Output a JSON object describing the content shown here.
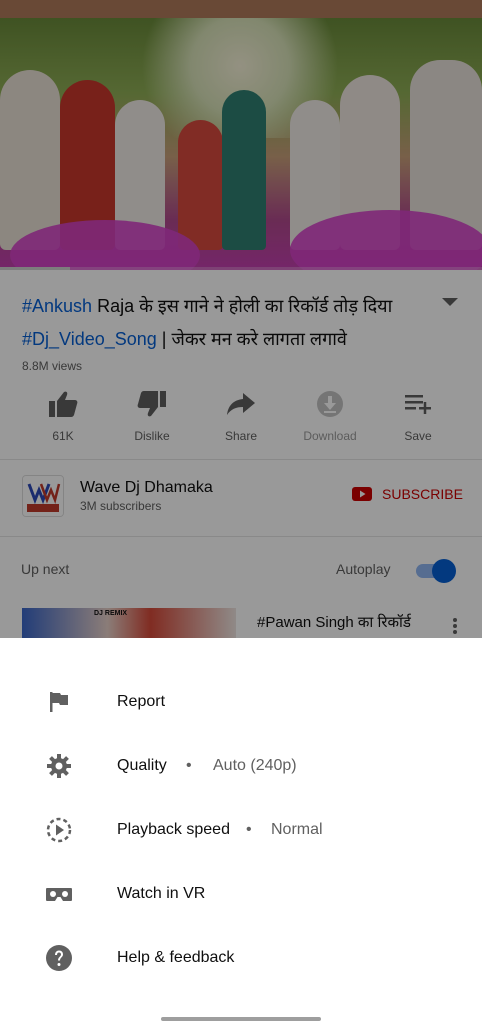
{
  "video": {
    "title_tag1": "#Ankush",
    "title_line1": " Raja के इस गाने ने होली का रिकॉर्ड तोड़ दिया",
    "title_tag2": "#Dj_Video_Song",
    "title_line2": " | जेकर मन करे लागता लगावे",
    "views": "8.8M views"
  },
  "actions": {
    "like": "61K",
    "dislike": "Dislike",
    "share": "Share",
    "download": "Download",
    "save": "Save"
  },
  "channel": {
    "name": "Wave Dj Dhamaka",
    "subscribers": "3M subscribers",
    "subscribe_label": "SUBSCRIBE",
    "avatar_text": "DJ DHAMAKA"
  },
  "upnext": {
    "label": "Up next",
    "autoplay_label": "Autoplay",
    "autoplay_on": true,
    "next_title": "#Pawan Singh का रिकॉर्ड",
    "thumb_badge": "DJ REMIX"
  },
  "menu": {
    "items": [
      {
        "icon": "flag-icon",
        "label": "Report"
      },
      {
        "icon": "gear-icon",
        "label": "Quality",
        "separator": "•",
        "value": "Auto (240p)"
      },
      {
        "icon": "playback-speed-icon",
        "label": "Playback speed",
        "separator": "•",
        "value": "Normal"
      },
      {
        "icon": "vr-headset-icon",
        "label": "Watch in VR"
      },
      {
        "icon": "help-icon",
        "label": "Help & feedback"
      }
    ]
  },
  "colors": {
    "accent": "#065fd4",
    "subscribe": "#cc0000",
    "overlay": "rgba(0,0,0,0.40)"
  }
}
